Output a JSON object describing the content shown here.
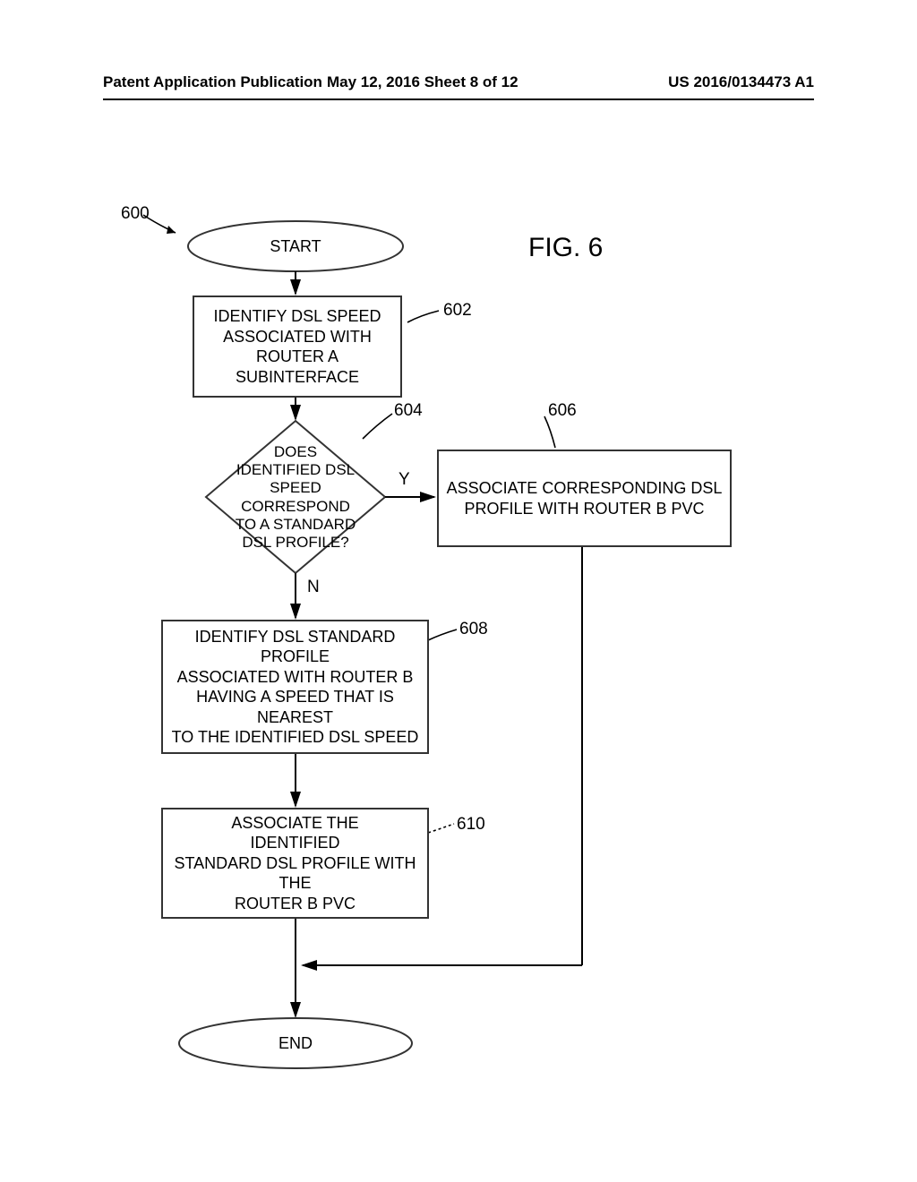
{
  "header": {
    "left": "Patent Application Publication",
    "center": "May 12, 2016 Sheet 8 of 12",
    "right": "US 2016/0134473 A1"
  },
  "figure_title": "FIG. 6",
  "flow_label": "600",
  "nodes": {
    "start": "START",
    "n602": "IDENTIFY DSL SPEED\nASSOCIATED WITH\nROUTER A\nSUBINTERFACE",
    "n604": "DOES\nIDENTIFIED DSL\nSPEED\nCORRESPOND\nTO A STANDARD\nDSL PROFILE?",
    "n606": "ASSOCIATE CORRESPONDING DSL\nPROFILE WITH ROUTER B PVC",
    "n608": "IDENTIFY DSL STANDARD PROFILE\nASSOCIATED WITH ROUTER B\nHAVING A SPEED THAT IS NEAREST\nTO THE IDENTIFIED DSL SPEED",
    "n610": "ASSOCIATE THE\nIDENTIFIED\nSTANDARD DSL PROFILE WITH THE\nROUTER B PVC",
    "end": "END"
  },
  "callouts": {
    "c600": "600",
    "c602": "602",
    "c604": "604",
    "c606": "606",
    "c608": "608",
    "c610": "610"
  },
  "branches": {
    "yes": "Y",
    "no": "N"
  }
}
